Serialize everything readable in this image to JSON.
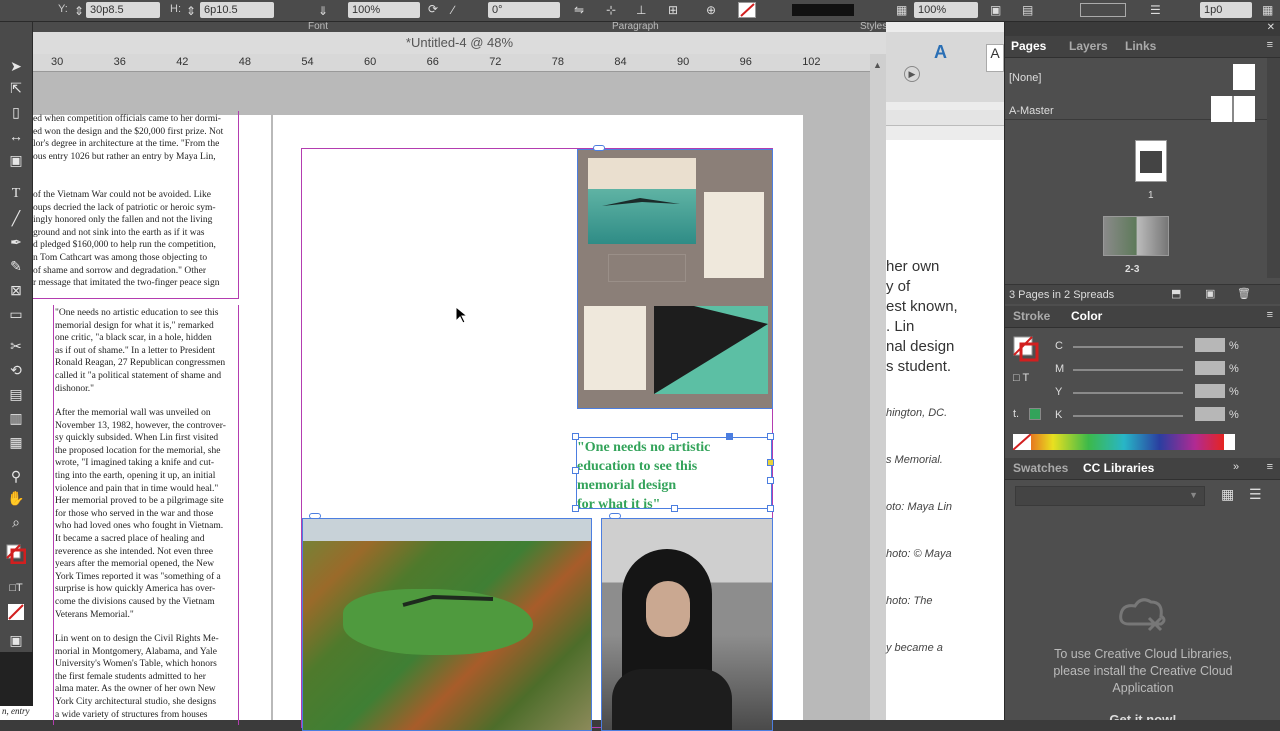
{
  "control_bar": {
    "y_label": "Y:",
    "y_value": "30p8.5",
    "h_label": "H:",
    "h_value": "6p10.5",
    "scale_value": "100%",
    "rotate_value": "0°",
    "opacity_value": "100%",
    "stroke_weight": "1p0",
    "caption_font": "Font",
    "caption_paragraph": "Paragraph",
    "caption_styles": "Styles"
  },
  "document": {
    "title": "*Untitled-4 @ 48%",
    "ruler_ticks": [
      "30",
      "36",
      "42",
      "48",
      "54",
      "60",
      "66",
      "72",
      "78",
      "84",
      "90",
      "96",
      "102"
    ]
  },
  "left_page": {
    "para1": [
      "ed when competition officials came to her dormi-",
      "ed won the design and the $20,000 first prize. Not",
      "lor's degree in architecture at the time. \"From the",
      "ous entry 1026 but rather an entry by Maya Lin,"
    ],
    "para2": [
      "of the Vietnam War could not be avoided. Like",
      "oups decried the lack of patriotic or heroic sym-",
      "ingly honored only the fallen and not the living",
      "ground and not sink into the earth as if it was",
      "d pledged $160,000 to help run the competition,",
      "n Tom Cathcart was among those objecting to",
      "of shame and sorrow and degradation.\" Other",
      "r message that imitated the two-finger peace sign"
    ],
    "col_a": [
      "\"One needs no artistic education to see this",
      "memorial design for what it is,\" remarked",
      "one critic, \"a black scar, in a hole, hidden",
      "as if out of shame.\" In a letter to President",
      "Ronald Reagan, 27 Republican congressmen",
      "called it \"a political statement of shame and",
      "dishonor.\""
    ],
    "col_b": [
      "After the memorial wall was unveiled on",
      "November 13, 1982, however, the controver-",
      "sy quickly subsided. When Lin first visited",
      "the proposed location for the memorial, she",
      "wrote, \"I imagined taking a knife and cut-",
      "ting into the earth, opening it up, an initial",
      "violence and pain that in time would heal.\"",
      "Her memorial proved to be a pilgrimage site",
      "for those who served in the war and those",
      "who had loved ones who fought in Vietnam.",
      "It became a sacred place of healing and",
      "reverence as she intended. Not even three",
      "years after the memorial opened, the New",
      "York Times reported it was \"something of a",
      "surprise is how quickly America has over-",
      "come the divisions caused by the Vietnam",
      "Veterans Memorial.\""
    ],
    "col_c": [
      "Lin went on to design the Civil Rights Me-",
      "morial in Montgomery, Alabama, and Yale",
      "University's Women's Table, which honors",
      "the first female students admitted to her",
      "alma mater. As the owner of her own New",
      "York City architectural studio, she designs",
      "a wide variety of structures from houses"
    ],
    "margin_note": "n, entry"
  },
  "right_page": {
    "pull_quote": [
      "\"One needs no artistic",
      "education to see this",
      "memorial design",
      "for what it is\""
    ]
  },
  "bg_document": {
    "lines": [
      "her own",
      "y of",
      "est known,",
      ". Lin",
      "nal design",
      "s student."
    ],
    "italic_lines": [
      "hington, DC.",
      "s Memorial.",
      "oto: Maya Lin",
      "hoto: © Maya",
      "hoto: The",
      "y became a"
    ]
  },
  "pages_panel": {
    "tabs": [
      "Pages",
      "Layers",
      "Links"
    ],
    "none_label": "[None]",
    "master_label": "A-Master",
    "page1_label": "1",
    "spread_label": "2-3",
    "status": "3 Pages in 2 Spreads"
  },
  "color_panel": {
    "tabs": [
      "Stroke",
      "Color"
    ],
    "channels": [
      "C",
      "M",
      "Y",
      "K"
    ],
    "percent": "%"
  },
  "libraries_panel": {
    "tabs": [
      "Swatches",
      "CC Libraries"
    ],
    "message": "To use Creative Cloud Libraries, please install the Creative Cloud Application",
    "cta": "Get it now!"
  },
  "colors": {
    "accent_green": "#33a35a",
    "selection_blue": "#4c7ee0",
    "frame_magenta": "#b33db0"
  }
}
